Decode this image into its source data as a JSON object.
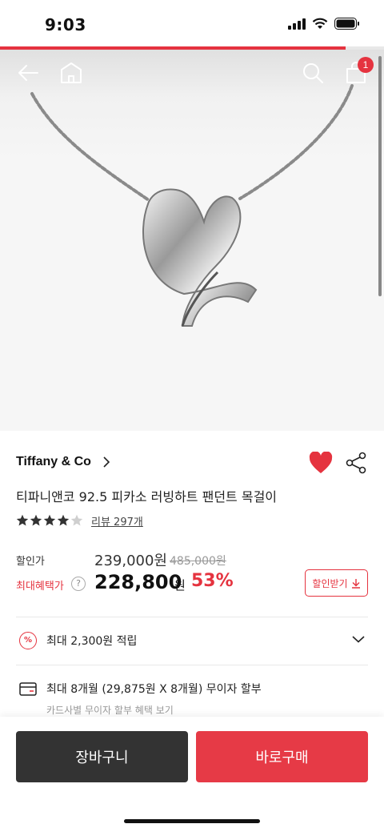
{
  "status_bar": {
    "time": "9:03"
  },
  "top_nav": {
    "cart_count": "1"
  },
  "page_progress": 0.9,
  "product": {
    "brand": "Tiffany & Co",
    "title": "티파니앤코 92.5 피카소 러빙하트 팬던트 목걸이",
    "rating": 4,
    "rating_max": 5,
    "review_link": "리뷰 297개",
    "favorited": true
  },
  "pricing": {
    "sale_label": "할인가",
    "sale_price": "239,000원",
    "original_price": "485,000원",
    "max_benefit_label": "최대혜택가",
    "help_icon": "?",
    "best_price": "228,800",
    "best_price_unit": "원",
    "discount_rate": "53%",
    "coupon_button": "할인받기"
  },
  "points": {
    "icon": "%",
    "text": "최대 2,300원 적립"
  },
  "installment": {
    "text": "최대 8개월 (29,875원 X 8개월) 무이자 할부",
    "sub": "카드사별 무이자 할부 혜택 보기"
  },
  "actions": {
    "cart": "장바구니",
    "buy": "바로구매"
  },
  "colors": {
    "accent": "#e5333f",
    "dark_button": "#333333",
    "buy_button": "#e63a46"
  }
}
